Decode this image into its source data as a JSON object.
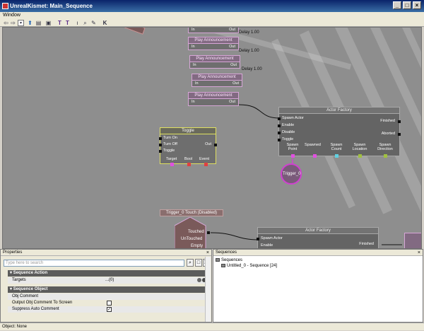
{
  "window": {
    "title": "UnrealKismet: Main_Sequence"
  },
  "menu": {
    "items": [
      "Window"
    ]
  },
  "toolbar": {
    "icons": [
      "back-arrow",
      "forward-arrow",
      "dropdown",
      "parent-sequence",
      "open-sequence",
      "screenshot",
      "text-tool-t",
      "text-tool-tt",
      "search-find",
      "search-class",
      "search-variable",
      "kismet-k"
    ]
  },
  "canvas": {
    "delay_label_1": "Delay 1.00",
    "delay_label_2": "Delay 1.00",
    "delay_label_3": "Delay 1.00",
    "play_nodes": [
      {
        "title": "Play Announcement",
        "in": "In",
        "out": "Out"
      },
      {
        "title": "Play Announcement",
        "in": "In",
        "out": "Out"
      },
      {
        "title": "Play Announcement",
        "in": "In",
        "out": "Out"
      },
      {
        "title": "Play Announcement",
        "in": "In",
        "out": "Out"
      }
    ],
    "top_pin_in": "In",
    "top_pin_out": "Out",
    "toggle": {
      "title": "Toggle",
      "inputs": [
        "Turn On",
        "Turn Off",
        "Toggle"
      ],
      "output": "Out",
      "vars": [
        "Target",
        "Bool",
        "Event"
      ]
    },
    "actor_factory_1": {
      "title": "Actor Factory",
      "inputs": [
        "Spawn Actor",
        "Enable",
        "Disable",
        "Toggle"
      ],
      "outputs": [
        "Finished",
        "Aborted"
      ],
      "vars": [
        "Spawn Point",
        "Spawned",
        "Spawn Count",
        "Spawn Location",
        "Spawn Direction"
      ]
    },
    "trigger_var": "Trigger_0",
    "trigger_event": {
      "title": "Trigger_0 Touch (Disabled)",
      "outputs": [
        "Touched",
        "UnTouched",
        "Empty"
      ]
    },
    "actor_factory_2": {
      "title": "Actor Factory",
      "inputs": [
        "Spawn Actor",
        "Enable"
      ],
      "outputs": [
        "Finished"
      ]
    }
  },
  "properties": {
    "title": "Properties",
    "search_placeholder": "Type here to search",
    "categories": [
      {
        "name": "Sequence Action",
        "rows": [
          {
            "label": "Targets",
            "value": "...(0)"
          }
        ]
      },
      {
        "name": "Sequence Object",
        "rows": [
          {
            "label": "Obj Comment",
            "value": ""
          },
          {
            "label": "Output Obj Comment To Screen",
            "checked": false
          },
          {
            "label": "Suppress Auto Comment",
            "checked": true
          }
        ]
      }
    ]
  },
  "sequences": {
    "title": "Sequences",
    "root": "Sequences",
    "child": "Untitled_0 - Sequence [24]"
  },
  "status": {
    "text": "Object: None"
  }
}
